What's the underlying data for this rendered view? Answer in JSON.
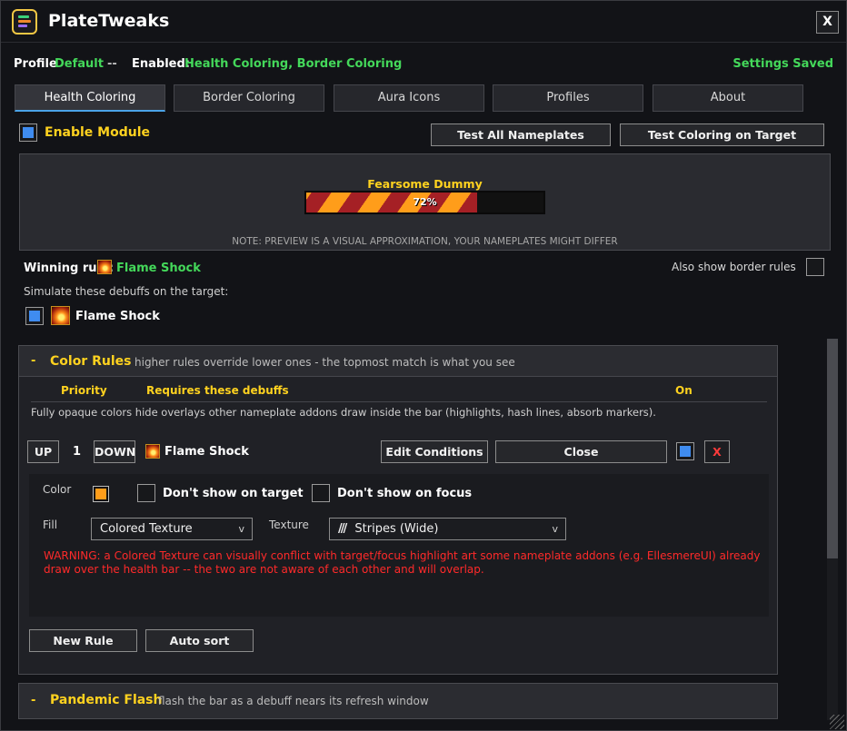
{
  "app": {
    "title": "PlateTweaks",
    "close_label": "X"
  },
  "status": {
    "profile_label": "Profile",
    "profile_value": "Default",
    "separator": "--",
    "enabled_label": "Enabled:",
    "enabled_value": "Health Coloring, Border Coloring",
    "saved": "Settings Saved"
  },
  "tabs": [
    {
      "label": "Health Coloring",
      "active": true
    },
    {
      "label": "Border Coloring"
    },
    {
      "label": "Aura Icons"
    },
    {
      "label": "Profiles"
    },
    {
      "label": "About"
    }
  ],
  "module": {
    "enable_label": "Enable Module",
    "enabled": true
  },
  "actions": {
    "test_all": "Test All Nameplates",
    "test_target": "Test Coloring on Target"
  },
  "preview": {
    "unit_name": "Fearsome Dummy",
    "health_percent": 72,
    "health_label": "72%",
    "note": "NOTE: PREVIEW IS A VISUAL APPROXIMATION, YOUR NAMEPLATES MIGHT DIFFER"
  },
  "winning": {
    "label": "Winning rule:",
    "rule": "Flame Shock"
  },
  "border_rules": {
    "label": "Also show border rules",
    "checked": false
  },
  "simulate": {
    "label": "Simulate these debuffs on the target:",
    "debuff": "Flame Shock",
    "checked": true
  },
  "color_rules": {
    "collapse": "-",
    "title": "Color Rules",
    "subtitle": "higher rules override lower ones - the topmost match is what you see",
    "col_priority": "Priority",
    "col_requires": "Requires these debuffs",
    "col_on": "On",
    "note": "Fully opaque colors hide overlays other nameplate addons draw inside the bar (highlights, hash lines, absorb markers).",
    "rule": {
      "up": "UP",
      "priority": "1",
      "down": "DOWN",
      "debuff": "Flame Shock",
      "edit": "Edit Conditions",
      "close": "Close",
      "on": true,
      "remove": "X",
      "color_label": "Color",
      "swatch": "#ff9d1a",
      "hide_target": "Don't show on target",
      "hide_focus": "Don't show on focus",
      "fill_label": "Fill",
      "fill_value": "Colored Texture",
      "texture_label": "Texture",
      "texture_value": "Stripes (Wide)",
      "warning": "WARNING: a Colored Texture can visually conflict with target/focus highlight art some nameplate addons (e.g. EllesmereUI) already draw over the health bar -- the two are not aware of each other and will overlap."
    },
    "new_rule": "New Rule",
    "auto_sort": "Auto sort"
  },
  "pandemic": {
    "collapse": "-",
    "title": "Pandemic Flash",
    "subtitle": "flash the bar as a debuff nears its refresh window"
  },
  "colors": {
    "accent": "#ffd21f",
    "green": "#44d85a",
    "warning": "#ff2a2a",
    "bar_red": "#a52025",
    "bar_orange": "#ff9d1a"
  }
}
